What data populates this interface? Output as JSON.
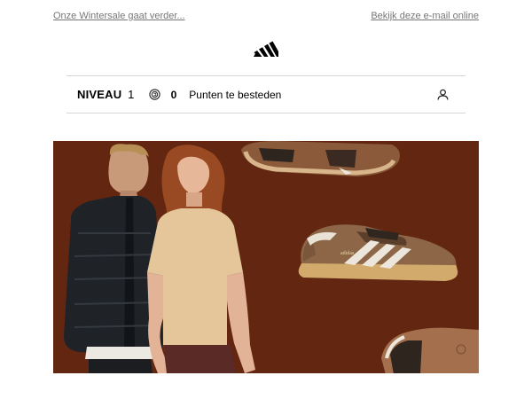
{
  "header": {
    "sale_link": "Onze Wintersale gaat verder...",
    "view_online_link": "Bekijk deze e-mail online"
  },
  "logo": {
    "name": "adidas-logo"
  },
  "membership": {
    "level_label": "NIVEAU",
    "level_value": "1",
    "points_value": "0",
    "points_label": "Punten te besteden",
    "points_icon": "coin-icon",
    "account_icon": "user-icon"
  },
  "hero": {
    "background_color": "#5e2410",
    "description_icon": "product-photo"
  },
  "colors": {
    "text_primary": "#000000",
    "link_muted": "#777777",
    "divider": "#d6d6d6",
    "hero_background": "#5e2410"
  }
}
